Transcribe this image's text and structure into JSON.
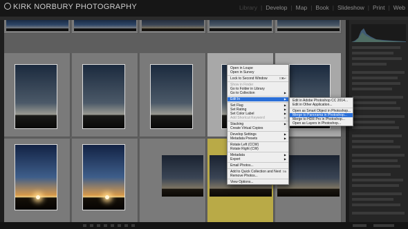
{
  "app": {
    "logo_text": "KIRK NORBURY PHOTOGRAPHY",
    "modules": [
      {
        "label": "Library",
        "active": false
      },
      {
        "label": "Develop",
        "active": true
      },
      {
        "label": "Map",
        "active": true
      },
      {
        "label": "Book",
        "active": true
      },
      {
        "label": "Slideshow",
        "active": true
      },
      {
        "label": "Print",
        "active": true
      },
      {
        "label": "Web",
        "active": true
      }
    ]
  },
  "context_menu": {
    "items": [
      {
        "label": "Open in Loupe",
        "enabled": true
      },
      {
        "label": "Open in Survey",
        "enabled": true
      },
      {
        "sep": true
      },
      {
        "label": "Lock to Second Window",
        "enabled": true,
        "shortcut": "⇧⌘↵"
      },
      {
        "sep": true
      },
      {
        "label": "Show in Finder",
        "enabled": false
      },
      {
        "label": "Go to Folder in Library",
        "enabled": true
      },
      {
        "label": "Go to Collection",
        "enabled": true,
        "submenu": true
      },
      {
        "sep": true
      },
      {
        "label": "Edit In",
        "enabled": true,
        "submenu": true,
        "highlighted": true
      },
      {
        "sep": true
      },
      {
        "label": "Set Flag",
        "enabled": true,
        "submenu": true
      },
      {
        "label": "Set Rating",
        "enabled": true,
        "submenu": true
      },
      {
        "label": "Set Color Label",
        "enabled": true,
        "submenu": true
      },
      {
        "label": "Add Shortcut Keyword",
        "enabled": false,
        "submenu": true
      },
      {
        "sep": true
      },
      {
        "label": "Stacking",
        "enabled": true,
        "submenu": true
      },
      {
        "label": "Create Virtual Copies",
        "enabled": true
      },
      {
        "sep": true
      },
      {
        "label": "Develop Settings",
        "enabled": true,
        "submenu": true
      },
      {
        "label": "Metadata Presets",
        "enabled": true,
        "submenu": true
      },
      {
        "sep": true
      },
      {
        "label": "Rotate Left (CCW)",
        "enabled": true
      },
      {
        "label": "Rotate Right (CW)",
        "enabled": true
      },
      {
        "sep": true
      },
      {
        "label": "Metadata",
        "enabled": true,
        "submenu": true
      },
      {
        "label": "Export",
        "enabled": true,
        "submenu": true
      },
      {
        "sep": true
      },
      {
        "label": "Email Photos...",
        "enabled": true
      },
      {
        "sep": true
      },
      {
        "label": "Add to Quick Collection and Next",
        "enabled": true,
        "shortcut": "⇧B"
      },
      {
        "label": "Remove Photos...",
        "enabled": true
      },
      {
        "sep": true
      },
      {
        "label": "View Options...",
        "enabled": true
      }
    ]
  },
  "edit_in_submenu": {
    "items": [
      {
        "label": "Edit in Adobe Photoshop CC 2014...",
        "highlighted": false
      },
      {
        "label": "Edit in Other Application...",
        "highlighted": false
      },
      {
        "sep": true
      },
      {
        "label": "Open as Smart Object in Photoshop...",
        "highlighted": false
      },
      {
        "label": "Merge to Panorama in Photoshop...",
        "highlighted": true
      },
      {
        "label": "Merge to HDR Pro in Photoshop...",
        "highlighted": false
      },
      {
        "label": "Open as Layers in Photoshop...",
        "highlighted": false
      }
    ]
  },
  "colors": {
    "menu_highlight": "#2b6fd8",
    "selected_cell": "#a8a8a8",
    "flagged_cell": "#b9aa47"
  }
}
